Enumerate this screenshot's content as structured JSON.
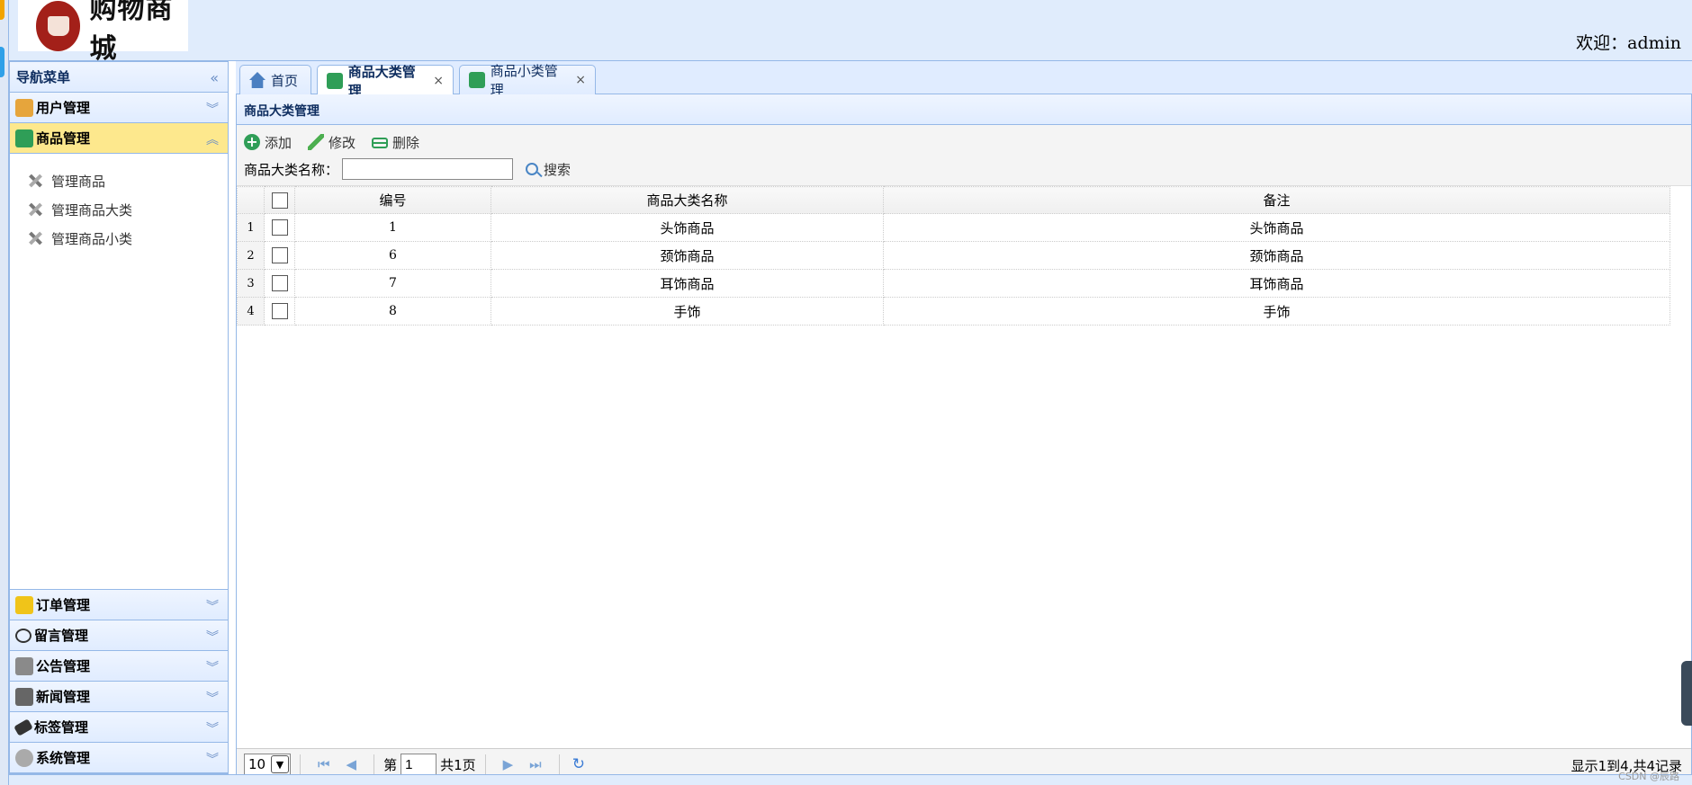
{
  "header": {
    "logo_text": "购物商城",
    "welcome": "欢迎：admin"
  },
  "sidebar": {
    "title": "导航菜单",
    "sections": [
      {
        "label": "用户管理",
        "icon": "users-icon",
        "expanded": false
      },
      {
        "label": "商品管理",
        "icon": "list-icon",
        "expanded": true,
        "items": [
          "管理商品",
          "管理商品大类",
          "管理商品小类"
        ]
      },
      {
        "label": "订单管理",
        "icon": "order-icon",
        "expanded": false
      },
      {
        "label": "留言管理",
        "icon": "comment-icon",
        "expanded": false
      },
      {
        "label": "公告管理",
        "icon": "notice-icon",
        "expanded": false
      },
      {
        "label": "新闻管理",
        "icon": "news-icon",
        "expanded": false
      },
      {
        "label": "标签管理",
        "icon": "tag-icon",
        "expanded": false
      },
      {
        "label": "系统管理",
        "icon": "gear-icon",
        "expanded": false
      }
    ]
  },
  "tabs": [
    {
      "label": "首页",
      "icon": "home-icon",
      "closable": false
    },
    {
      "label": "商品大类管理",
      "icon": "list-icon",
      "closable": true,
      "selected": true
    },
    {
      "label": "商品小类管理",
      "icon": "list-icon",
      "closable": true
    }
  ],
  "panel": {
    "title": "商品大类管理",
    "toolbar": {
      "add": "添加",
      "edit": "修改",
      "delete": "删除",
      "search_label": "商品大类名称：",
      "search_value": "",
      "search_button": "搜索"
    },
    "grid": {
      "columns": [
        "编号",
        "商品大类名称",
        "备注"
      ],
      "rows": [
        {
          "n": "1",
          "id": "1",
          "name": "头饰商品",
          "remark": "头饰商品"
        },
        {
          "n": "2",
          "id": "6",
          "name": "颈饰商品",
          "remark": "颈饰商品"
        },
        {
          "n": "3",
          "id": "7",
          "name": "耳饰商品",
          "remark": "耳饰商品"
        },
        {
          "n": "4",
          "id": "8",
          "name": "手饰",
          "remark": "手饰"
        }
      ]
    },
    "pager": {
      "page_size": "10",
      "page_prefix": "第",
      "page_value": "1",
      "page_suffix": "共1页",
      "info": "显示1到4,共4记录"
    }
  },
  "watermark": "CSDN @辰路",
  "colors": {
    "accent_border": "#95b8e7",
    "header_bg": "#e0ecfc",
    "active_section": "#fde88d"
  }
}
